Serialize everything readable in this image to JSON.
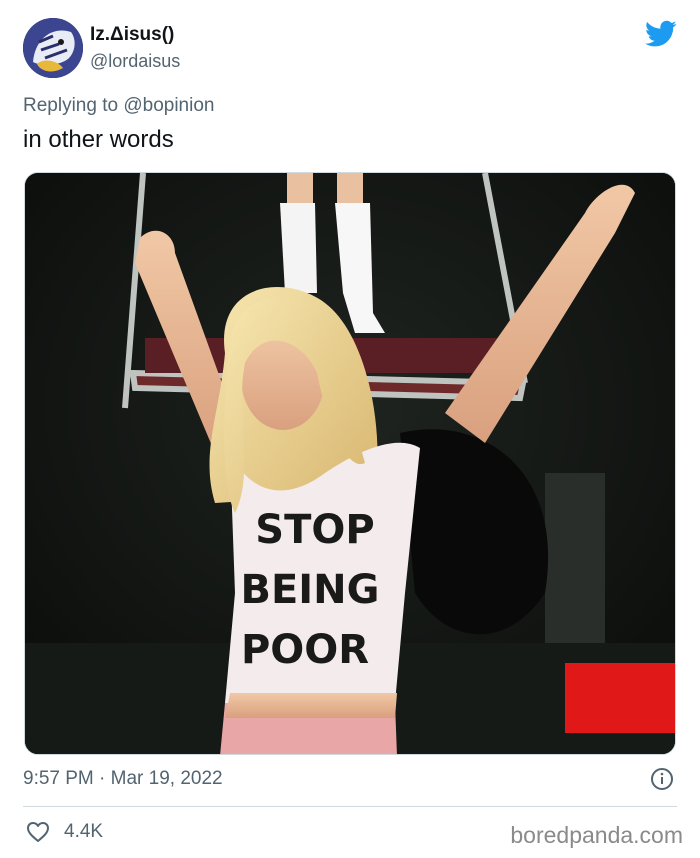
{
  "tweet": {
    "display_name": "Iz.Δisus()",
    "handle": "@lordaisus",
    "reply_prefix": "Replying to",
    "reply_to": "@bopinion",
    "text": "in other words",
    "timestamp": "9:57 PM · Mar 19, 2022",
    "like_count": "4.4K"
  },
  "photo": {
    "shirt_lines": [
      "STOP",
      "BEING",
      "POOR"
    ]
  },
  "watermark": "boredpanda.com",
  "colors": {
    "twitter_blue": "#1d9bf0",
    "secondary_text": "#536471",
    "border": "#cfd9de"
  },
  "icons": {
    "brand": "twitter-bird-icon",
    "info": "info-icon",
    "like": "heart-icon"
  }
}
